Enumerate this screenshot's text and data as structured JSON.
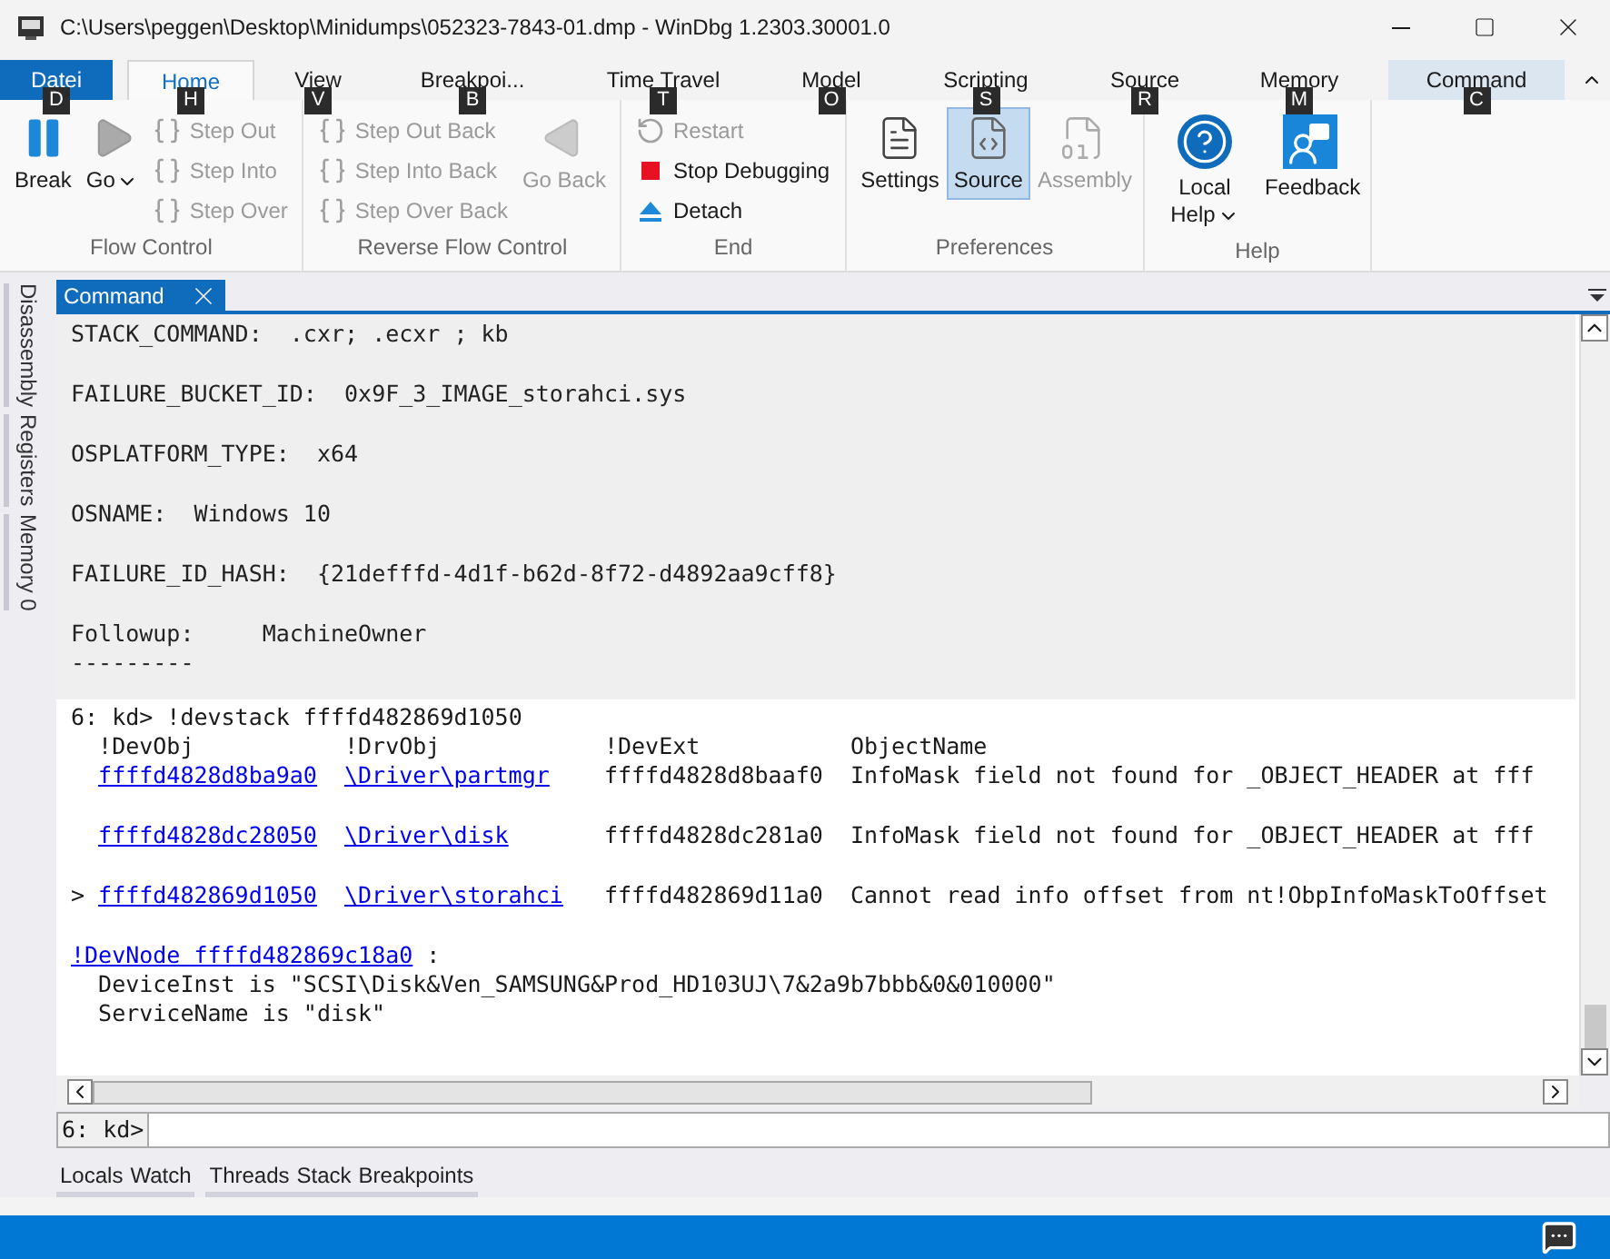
{
  "window": {
    "title": "C:\\Users\\peggen\\Desktop\\Minidumps\\052323-7843-01.dmp - WinDbg 1.2303.30001.0"
  },
  "ribbon": {
    "tabs": [
      {
        "label": "Datei",
        "keytip": "D",
        "kind": "file",
        "selected": false
      },
      {
        "label": "Home",
        "keytip": "H",
        "kind": "normal",
        "selected": true
      },
      {
        "label": "View",
        "keytip": "V",
        "kind": "normal",
        "selected": false
      },
      {
        "label": "Breakpoi...",
        "keytip": "B",
        "kind": "normal",
        "selected": false
      },
      {
        "label": "Time Travel",
        "keytip": "T",
        "kind": "normal",
        "selected": false
      },
      {
        "label": "Model",
        "keytip": "O",
        "kind": "normal",
        "selected": false
      },
      {
        "label": "Scripting",
        "keytip": "S",
        "kind": "normal",
        "selected": false
      },
      {
        "label": "Source",
        "keytip": "R",
        "kind": "normal",
        "selected": false
      },
      {
        "label": "Memory",
        "keytip": "M",
        "kind": "normal",
        "selected": false
      },
      {
        "label": "Command",
        "keytip": "C",
        "kind": "contextual",
        "selected": false
      }
    ],
    "groups": [
      {
        "label": "Flow Control",
        "items": [
          {
            "kind": "large",
            "label": "Break",
            "disabled": false
          },
          {
            "kind": "large",
            "label": "Go",
            "disabled": false,
            "dropdown": true
          },
          {
            "kind": "stack",
            "items": [
              {
                "label": "Step Out",
                "disabled": true
              },
              {
                "label": "Step Into",
                "disabled": true
              },
              {
                "label": "Step Over",
                "disabled": true
              }
            ]
          }
        ]
      },
      {
        "label": "Reverse Flow Control",
        "items": [
          {
            "kind": "stack",
            "items": [
              {
                "label": "Step Out Back",
                "disabled": true
              },
              {
                "label": "Step Into Back",
                "disabled": true
              },
              {
                "label": "Step Over Back",
                "disabled": true
              }
            ]
          },
          {
            "kind": "large",
            "label": "Go Back",
            "disabled": true
          }
        ]
      },
      {
        "label": "End",
        "items": [
          {
            "kind": "stack",
            "items": [
              {
                "label": "Restart",
                "disabled": true
              },
              {
                "label": "Stop Debugging",
                "disabled": false
              },
              {
                "label": "Detach",
                "disabled": false
              }
            ]
          }
        ]
      },
      {
        "label": "Preferences",
        "items": [
          {
            "kind": "large",
            "label": "Settings",
            "disabled": false,
            "selected": false
          },
          {
            "kind": "large",
            "label": "Source",
            "disabled": false,
            "selected": true
          },
          {
            "kind": "large",
            "label": "Assembly",
            "disabled": true,
            "selected": false
          }
        ]
      },
      {
        "label": "Help",
        "items": [
          {
            "kind": "large",
            "label": "Local Help",
            "disabled": false,
            "dropdown": true
          },
          {
            "kind": "large",
            "label": "Feedback",
            "disabled": false
          }
        ]
      }
    ]
  },
  "side_tabs": [
    "Disassembly",
    "Registers",
    "Memory 0"
  ],
  "panel": {
    "tab": "Command",
    "history": [
      [
        "STACK_COMMAND:  .cxr; .ecxr ; kb"
      ],
      [
        "FAILURE_BUCKET_ID:  0x9F_3_IMAGE_storahci.sys"
      ],
      [
        "OSPLATFORM_TYPE:  x64"
      ],
      [
        "OSNAME:  Windows 10"
      ],
      [
        "FAILURE_ID_HASH:  {21defffd-4d1f-b62d-8f72-d4892aa9cff8}"
      ],
      [
        "Followup:     MachineOwner",
        "---------"
      ]
    ],
    "command": "6: kd> !devstack ffffd482869d1050",
    "columns": [
      "!DevObj",
      "!DrvObj",
      "!DevExt",
      "ObjectName"
    ],
    "rows": [
      {
        "devobj": "ffffd4828d8ba9a0",
        "drvobj": "\\Driver\\partmgr",
        "devext": "ffffd4828d8baaf0",
        "object_name": "InfoMask field not found for _OBJECT_HEADER at fff"
      },
      {
        "devobj": "ffffd4828dc28050",
        "drvobj": "\\Driver\\disk",
        "devext": "ffffd4828dc281a0",
        "object_name": "InfoMask field not found for _OBJECT_HEADER at fff"
      },
      {
        "marker": ">",
        "devobj": "ffffd482869d1050",
        "drvobj": "\\Driver\\storahci",
        "devext": "ffffd482869d11a0",
        "object_name": "Cannot read info offset from nt!ObpInfoMaskToOffset"
      }
    ],
    "devnode": {
      "link": "!DevNode ffffd482869c18a0",
      "suffix": " :",
      "lines": [
        "DeviceInst is \"SCSI\\Disk&Ven_SAMSUNG&Prod_HD103UJ\\7&2a9b7bbb&0&010000\"",
        "ServiceName is \"disk\""
      ]
    },
    "prompt": "6: kd>"
  },
  "bottom_tabs": [
    [
      "Locals",
      "Watch"
    ],
    [
      "Threads",
      "Stack",
      "Breakpoints"
    ]
  ]
}
